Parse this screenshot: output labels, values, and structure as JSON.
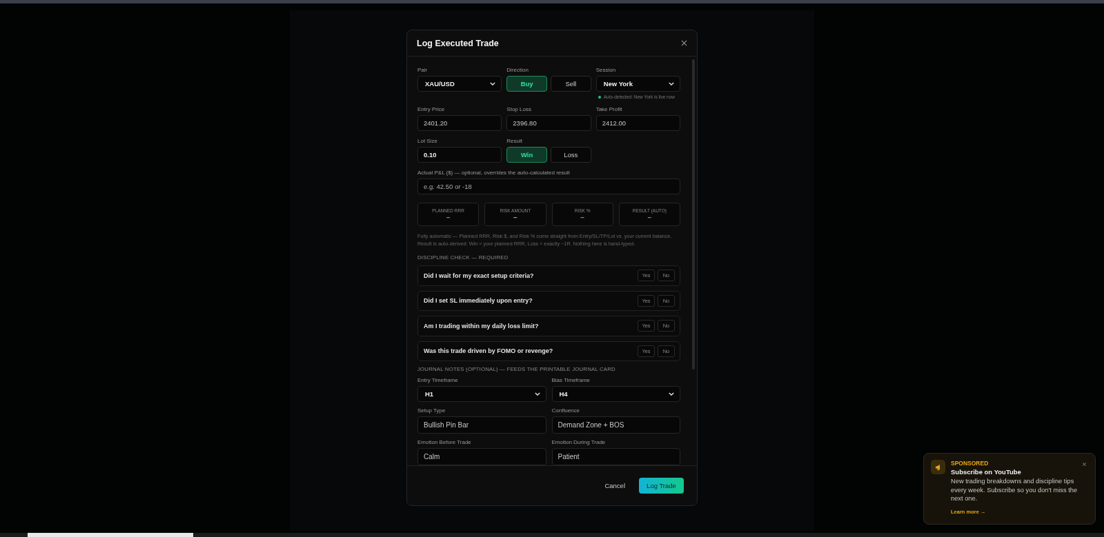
{
  "modal": {
    "title": "Log Executed Trade",
    "pair": {
      "label": "Pair",
      "value": "XAU/USD"
    },
    "direction": {
      "label": "Direction",
      "options": [
        {
          "label": "Buy",
          "selected": true
        },
        {
          "label": "Sell",
          "selected": false
        }
      ]
    },
    "session": {
      "label": "Session",
      "value": "New York",
      "hint": "Auto-detected: New York is live now"
    },
    "prices": [
      {
        "label": "Entry Price",
        "value": "2401.20"
      },
      {
        "label": "Stop Loss",
        "value": "2396.80"
      },
      {
        "label": "Take Profit",
        "value": "2412.00"
      }
    ],
    "lot_size": {
      "label": "Lot Size",
      "value": "0.10"
    },
    "result": {
      "label": "Result",
      "options": [
        {
          "label": "Win",
          "selected": true
        },
        {
          "label": "Loss",
          "selected": false
        }
      ]
    },
    "pnl": {
      "label": "Actual P&L ($) — optional, overrides the auto-calculated result",
      "placeholder": "e.g. 42.50 or -18"
    },
    "stats": [
      {
        "label": "PLANNED RRR",
        "value": "–",
        "color": "#1fb8d6"
      },
      {
        "label": "RISK AMOUNT",
        "value": "–",
        "color": "#e0a818"
      },
      {
        "label": "RISK %",
        "value": "–",
        "color": "#18c98a"
      },
      {
        "label": "RESULT (AUTO)",
        "value": "–",
        "color": "#1fb8d6"
      }
    ],
    "note": "Fully automatic — Planned RRR, Risk $, and Risk % come straight from Entry/SL/TP/Lot vs. your current balance. Result is auto-derived: Win = your planned RRR, Loss = exactly −1R. Nothing here is hand-typed.",
    "discipline": {
      "heading": "DISCIPLINE CHECK — REQUIRED",
      "questions": [
        {
          "text": "Did I wait for my exact setup criteria?",
          "options": [
            {
              "label": "Yes",
              "selected": false
            },
            {
              "label": "No",
              "selected": false
            }
          ]
        },
        {
          "text": "Did I set SL immediately upon entry?",
          "options": [
            {
              "label": "Yes",
              "selected": false
            },
            {
              "label": "No",
              "selected": false
            }
          ]
        },
        {
          "text": "Am I trading within my daily loss limit?",
          "options": [
            {
              "label": "Yes",
              "selected": false
            },
            {
              "label": "No",
              "selected": false
            }
          ]
        },
        {
          "text": "Was this trade driven by FOMO or revenge?",
          "options": [
            {
              "label": "Yes",
              "selected": false
            },
            {
              "label": "No",
              "selected": false
            }
          ]
        }
      ]
    },
    "journal": {
      "heading": "JOURNAL NOTES (OPTIONAL) — FEEDS THE PRINTABLE JOURNAL CARD",
      "fields": [
        {
          "kind": "select",
          "label": "Entry Timeframe",
          "value": "H1"
        },
        {
          "kind": "select",
          "label": "Bias Timeframe",
          "value": "H4"
        },
        {
          "kind": "input",
          "label": "Setup Type",
          "value": "Bullish Pin Bar"
        },
        {
          "kind": "input",
          "label": "Confluence",
          "value": "Demand Zone + BOS"
        },
        {
          "kind": "input",
          "label": "Emotion Before Trade",
          "value": "Calm"
        },
        {
          "kind": "input",
          "label": "Emotion During Trade",
          "value": "Patient"
        }
      ]
    },
    "buttons": {
      "cancel": "Cancel",
      "submit": "Log Trade"
    }
  },
  "sponsor": {
    "tag": "SPONSORED",
    "title": "Subscribe on YouTube",
    "body": "New trading breakdowns and discipline tips every week. Subscribe so you don't miss the next one.",
    "link": "Learn more →"
  }
}
